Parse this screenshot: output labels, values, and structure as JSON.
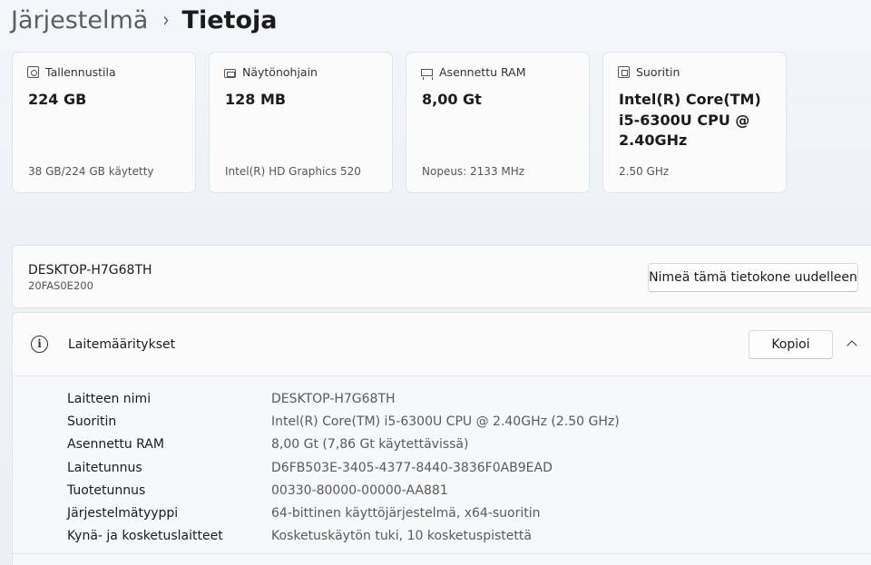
{
  "breadcrumb": {
    "parent": "Järjestelmä",
    "separator": "›",
    "current": "Tietoja"
  },
  "cards": [
    {
      "icon": "storage-icon",
      "label": "Tallennustila",
      "value": "224 GB",
      "sub": "38 GB/224 GB käytetty"
    },
    {
      "icon": "display-adapter-icon",
      "label": "Näytönohjain",
      "value": "128 MB",
      "sub": "Intel(R) HD Graphics 520"
    },
    {
      "icon": "ram-icon",
      "label": "Asennettu RAM",
      "value": "8,00 Gt",
      "sub": "Nopeus: 2133 MHz"
    },
    {
      "icon": "processor-icon",
      "label": "Suoritin",
      "value": "Intel(R) Core(TM) i5-6300U CPU @ 2.40GHz",
      "sub": "2.50 GHz"
    }
  ],
  "device": {
    "name": "DESKTOP-H7G68TH",
    "model": "20FAS0E200",
    "rename_label": "Nimeä tämä tietokone uudelleen"
  },
  "specs": {
    "title": "Laitemääritykset",
    "copy_label": "Kopioi",
    "rows": [
      {
        "key": "Laitteen nimi",
        "value": "DESKTOP-H7G68TH"
      },
      {
        "key": "Suoritin",
        "value": "Intel(R) Core(TM) i5-6300U CPU @ 2.40GHz (2.50 GHz)"
      },
      {
        "key": "Asennettu RAM",
        "value": "8,00 Gt (7,86 Gt käytettävissä)"
      },
      {
        "key": "Laitetunnus",
        "value": "D6FB503E-3405-4377-8440-3836F0AB9EAD"
      },
      {
        "key": "Tuotetunnus",
        "value": "00330-80000-00000-AA881"
      },
      {
        "key": "Järjestelmätyyppi",
        "value": "64-bittinen käyttöjärjestelmä, x64-suoritin"
      },
      {
        "key": "Kynä- ja kosketuslaitteet",
        "value": "Kosketuskäytön tuki, 10 kosketuspistettä"
      }
    ]
  }
}
